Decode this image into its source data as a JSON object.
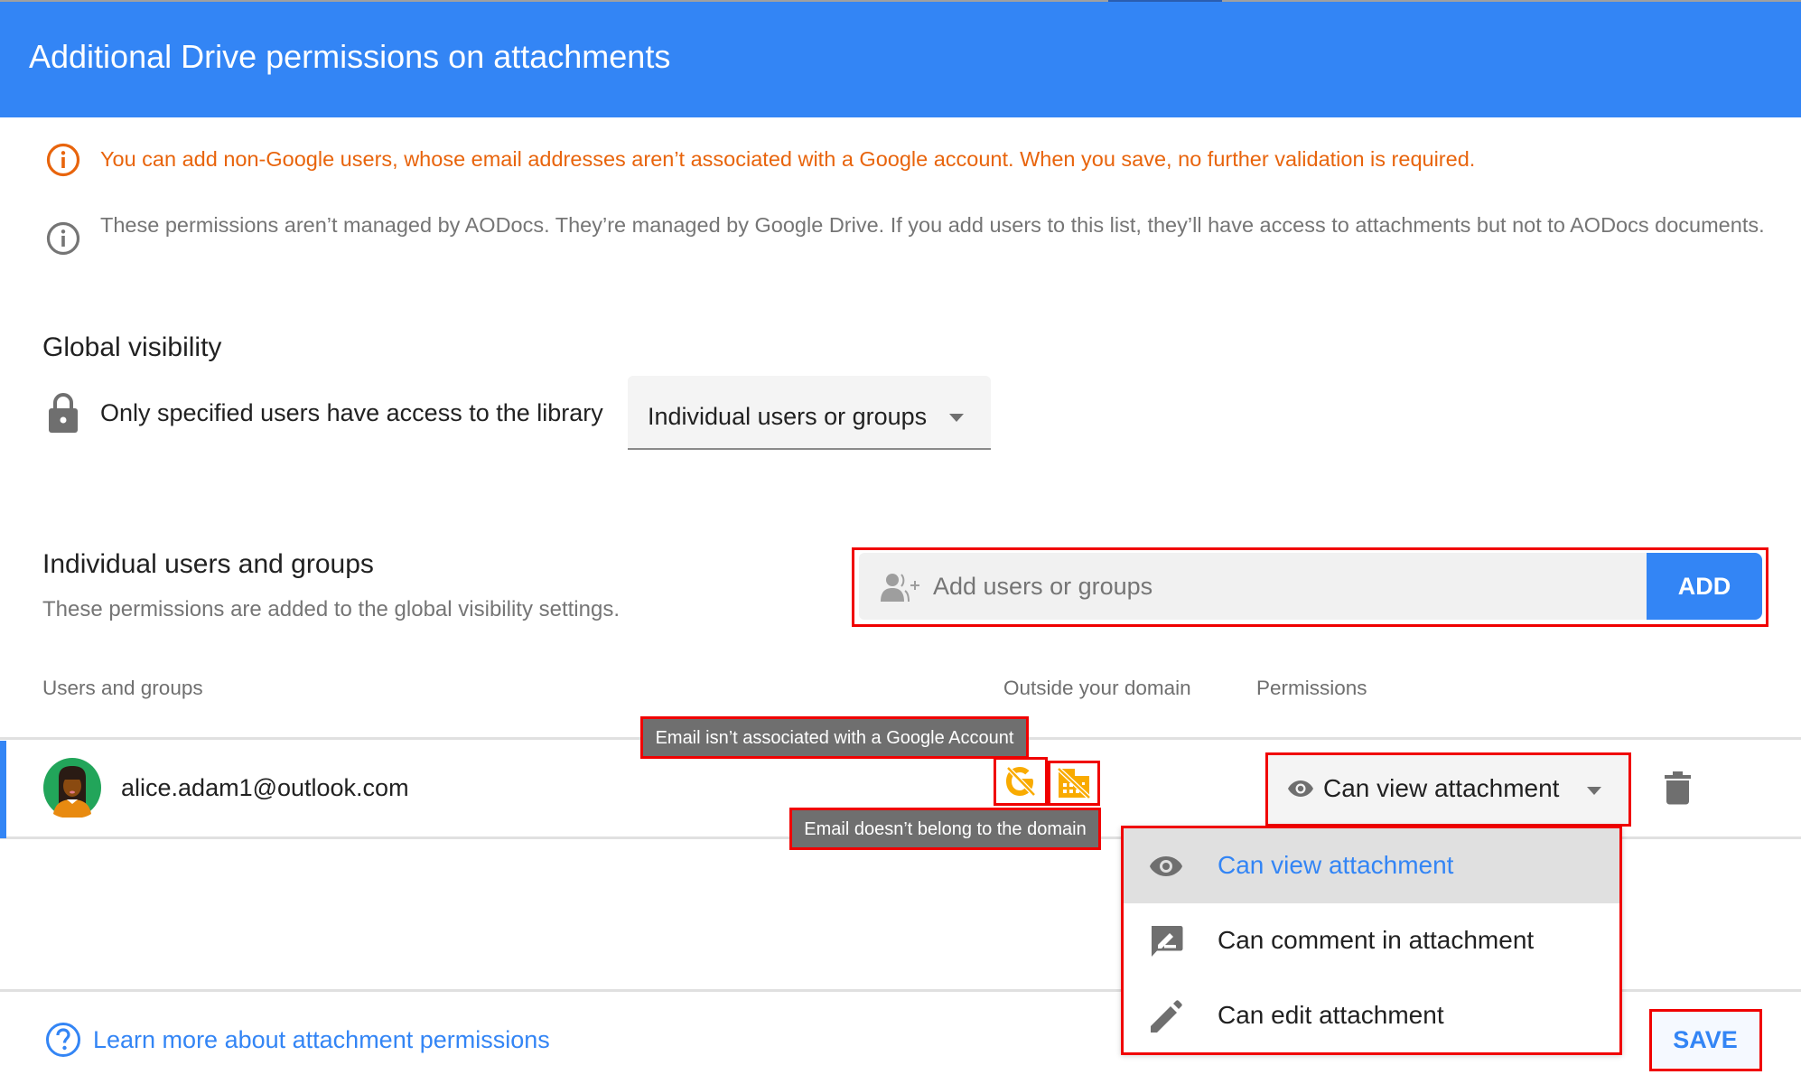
{
  "dialog": {
    "title": "Additional Drive permissions on attachments"
  },
  "notices": {
    "warning": "You can add non-Google users, whose email addresses aren’t associated with a Google account. When you save, no further validation is required.",
    "info": "These permissions aren’t managed by AODocs. They’re managed by Google Drive. If you add users to this list, they’ll have access to attachments but not to AODocs documents."
  },
  "global_visibility": {
    "title": "Global visibility",
    "description": "Only specified users have access to the library",
    "selected": "Individual users or groups"
  },
  "individual": {
    "title": "Individual users and groups",
    "subtitle": "These permissions are added to the global visibility settings.",
    "add_placeholder": "Add users or groups",
    "add_button": "ADD"
  },
  "table": {
    "columns": {
      "users": "Users and groups",
      "outside_domain": "Outside your domain",
      "permissions": "Permissions"
    },
    "rows": [
      {
        "email": "alice.adam1@outlook.com",
        "icons": [
          "no-google-account-icon",
          "outside-domain-icon"
        ],
        "permission": "Can view attachment"
      }
    ]
  },
  "tooltips": {
    "no_google_account": "Email isn’t associated with a Google Account",
    "outside_domain": "Email doesn’t belong to the domain"
  },
  "permission_menu": {
    "items": [
      {
        "label": "Can view attachment",
        "icon": "eye-icon",
        "selected": true
      },
      {
        "label": "Can comment in attachment",
        "icon": "comment-icon",
        "selected": false
      },
      {
        "label": "Can edit attachment",
        "icon": "pencil-icon",
        "selected": false
      }
    ]
  },
  "footer": {
    "learn_more": "Learn more about attachment permissions",
    "save": "SAVE"
  },
  "colors": {
    "primary": "#3385f5",
    "warning": "#e8640c",
    "alert_icon": "#f9ab00",
    "highlight_outline": "#f00000"
  }
}
